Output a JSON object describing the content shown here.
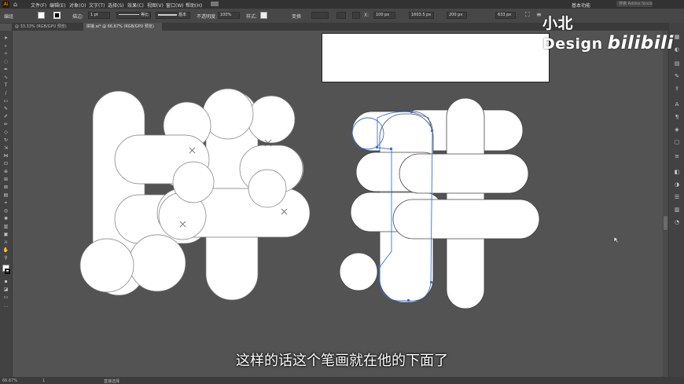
{
  "app": {
    "logo": "Ai",
    "home_icon": "home-icon"
  },
  "menu": [
    "文件(F)",
    "编辑(E)",
    "对象(O)",
    "文字(T)",
    "选择(S)",
    "效果(C)",
    "视图(V)",
    "窗口(W)",
    "帮助(H)"
  ],
  "workspace_label": "基本功能",
  "search_placeholder": "搜索 Adobe Stock",
  "options": {
    "selection_label": "编组",
    "stroke_label": "描边:",
    "stroke_value": "1 pt",
    "stroke_profile": "等比",
    "brush": "基本",
    "opacity_label": "不透明度:",
    "opacity_value": "100%",
    "style_label": "样式:",
    "transform_label": "变换",
    "x_label": "X:",
    "x_value": "100 px",
    "w_value": "1603.5 px",
    "h_value": "200 px",
    "angle_value": "633 px"
  },
  "tabs": [
    {
      "label": "@ 33.33% (RGB/GPU 预览)",
      "active": false
    },
    {
      "label": "拼接.ai* @ 66.67% (RGB/GPU 预览)",
      "active": true
    }
  ],
  "status": {
    "zoom": "66.67%",
    "artboard": "1",
    "tool": "直接选择"
  },
  "watermark": {
    "text": "小北Design",
    "brand": "bilibili"
  },
  "subtitle": "这样的话这个笔画就在他的下面了",
  "colors": {
    "canvas": "#535353",
    "chrome": "#424242",
    "path_selection": "#3a6fd8",
    "glyph_fill": "#ffffff"
  }
}
